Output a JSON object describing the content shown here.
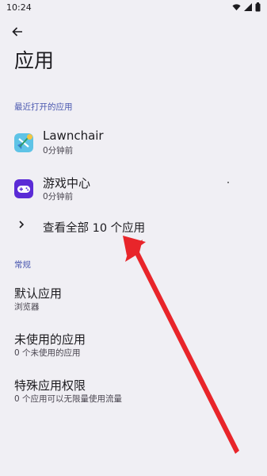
{
  "status_bar": {
    "time": "10:24",
    "icons": [
      "wifi-icon",
      "signal-icon",
      "battery-icon"
    ]
  },
  "header": {
    "back_icon": "arrow-left-icon",
    "title": "应用"
  },
  "recent": {
    "header": "最近打开的应用",
    "apps": [
      {
        "name": "Lawnchair",
        "sub": "0分钟前",
        "icon": "lawnchair-icon"
      },
      {
        "name": "游戏中心",
        "sub": "0分钟前",
        "icon": "game-center-icon"
      }
    ],
    "see_all": "查看全部 10 个应用"
  },
  "general": {
    "header": "常规",
    "items": [
      {
        "title": "默认应用",
        "sub": "浏览器"
      },
      {
        "title": "未使用的应用",
        "sub": "0 个未使用的应用"
      },
      {
        "title": "特殊应用权限",
        "sub": "0 个应用可以无限量使用流量"
      }
    ]
  },
  "colors": {
    "background": "#f0eff4",
    "section_header": "#4b59b0",
    "annotation_arrow": "#e8252a"
  }
}
